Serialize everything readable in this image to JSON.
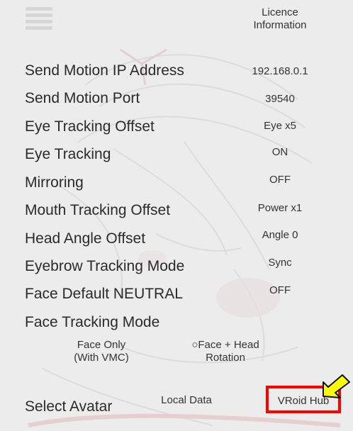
{
  "header": {
    "licence_label": "Licence\nInformation"
  },
  "settings": [
    {
      "label": "Send Motion IP Address",
      "value": "192.168.0.1"
    },
    {
      "label": "Send Motion Port",
      "value": "39540"
    },
    {
      "label": "Eye Tracking Offset",
      "value": "Eye x5"
    },
    {
      "label": "Eye Tracking",
      "value": "ON"
    },
    {
      "label": "Mirroring",
      "value": "OFF"
    },
    {
      "label": "Mouth Tracking Offset",
      "value": "Power x1"
    },
    {
      "label": "Head Angle Offset",
      "value": "Angle 0"
    },
    {
      "label": "Eyebrow Tracking Mode",
      "value": "Sync"
    },
    {
      "label": "Face Default NEUTRAL",
      "value": "OFF"
    },
    {
      "label": "Face Tracking Mode",
      "value": ""
    }
  ],
  "face_tracking_options": {
    "option_1": "Face Only\n(With VMC)",
    "option_2": "○Face + Head\nRotation"
  },
  "avatar": {
    "label": "Select Avatar",
    "local_data": "Local Data",
    "vroid_hub": "VRoid Hub"
  },
  "colors": {
    "background": "#ececec",
    "highlight_box": "#ff0000",
    "arrow_fill": "#ffff00"
  }
}
